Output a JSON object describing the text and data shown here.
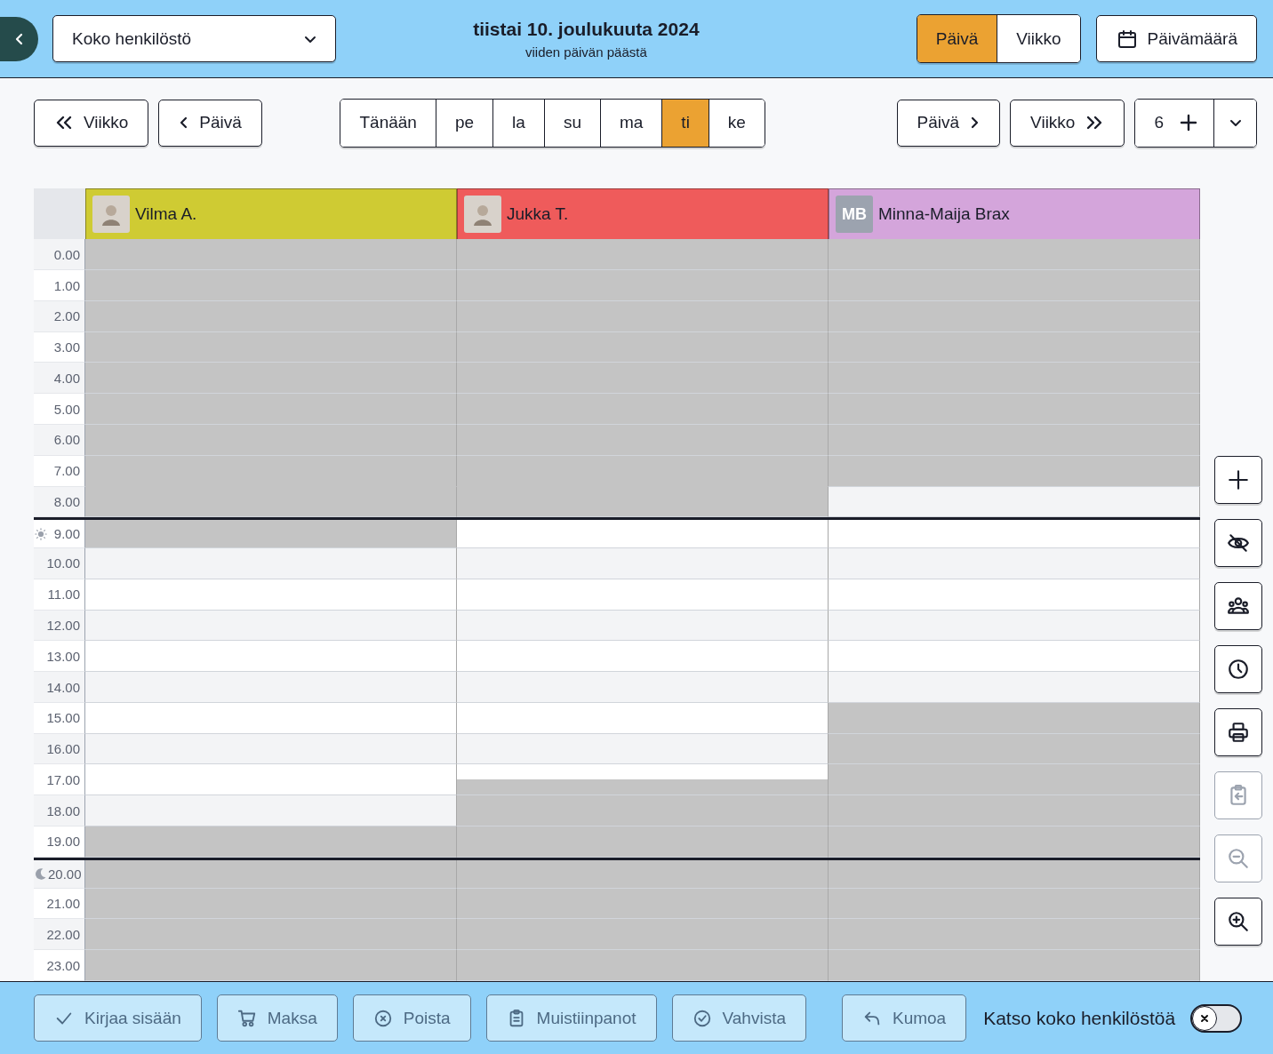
{
  "header": {
    "staff_filter": {
      "value": "Koko henkilöstö"
    },
    "date_title": "tiistai 10. joulukuuta 2024",
    "date_subtitle": "viiden päivän päästä",
    "view_tabs": [
      {
        "label": "Päivä",
        "selected": true
      },
      {
        "label": "Viikko",
        "selected": false
      }
    ],
    "date_button": "Päivämäärä"
  },
  "nav": {
    "back": [
      {
        "label": "Viikko",
        "kind": "week"
      },
      {
        "label": "Päivä",
        "kind": "day"
      }
    ],
    "days": [
      {
        "label": "Tänään",
        "selected": false
      },
      {
        "label": "pe",
        "selected": false
      },
      {
        "label": "la",
        "selected": false
      },
      {
        "label": "su",
        "selected": false
      },
      {
        "label": "ma",
        "selected": false
      },
      {
        "label": "ti",
        "selected": true
      },
      {
        "label": "ke",
        "selected": false
      }
    ],
    "forward": [
      {
        "label": "Päivä",
        "kind": "day"
      },
      {
        "label": "Viikko",
        "kind": "week"
      }
    ],
    "count": "6"
  },
  "calendar": {
    "staff": [
      {
        "name": "Vilma A.",
        "color": "#cfcb33",
        "half_hours": [
          {
            "blocked": true
          },
          {
            "blocked": true
          },
          {
            "blocked": true
          },
          {
            "blocked": true
          },
          {
            "blocked": true
          },
          {
            "blocked": true
          },
          {
            "blocked": true
          },
          {
            "blocked": true
          },
          {
            "blocked": true
          },
          {
            "blocked": true
          },
          {
            "blocked": true
          },
          {
            "blocked": true
          },
          {
            "blocked": true
          },
          {
            "blocked": true
          },
          {
            "blocked": true
          },
          {
            "blocked": true
          },
          {
            "blocked": true
          },
          {
            "blocked": true
          },
          {
            "blocked": true
          },
          {
            "blocked": true
          },
          {
            "blocked": false
          },
          {
            "blocked": false
          },
          {
            "blocked": false
          },
          {
            "blocked": false
          },
          {
            "blocked": false
          },
          {
            "blocked": false
          },
          {
            "blocked": false
          },
          {
            "blocked": false
          },
          {
            "blocked": false
          },
          {
            "blocked": false
          },
          {
            "blocked": false
          },
          {
            "blocked": false
          },
          {
            "blocked": false
          },
          {
            "blocked": false
          },
          {
            "blocked": false
          },
          {
            "blocked": false
          },
          {
            "blocked": false
          },
          {
            "blocked": false
          },
          {
            "blocked": true
          },
          {
            "blocked": true
          },
          {
            "blocked": true
          },
          {
            "blocked": true
          },
          {
            "blocked": true
          },
          {
            "blocked": true
          },
          {
            "blocked": true
          },
          {
            "blocked": true
          },
          {
            "blocked": true
          },
          {
            "blocked": true
          }
        ]
      },
      {
        "name": "Jukka T.",
        "color": "#ef5b5b",
        "half_hours": [
          {
            "blocked": true
          },
          {
            "blocked": true
          },
          {
            "blocked": true
          },
          {
            "blocked": true
          },
          {
            "blocked": true
          },
          {
            "blocked": true
          },
          {
            "blocked": true
          },
          {
            "blocked": true
          },
          {
            "blocked": true
          },
          {
            "blocked": true
          },
          {
            "blocked": true
          },
          {
            "blocked": true
          },
          {
            "blocked": true
          },
          {
            "blocked": true
          },
          {
            "blocked": true
          },
          {
            "blocked": true
          },
          {
            "blocked": true
          },
          {
            "blocked": true
          },
          {
            "blocked": false
          },
          {
            "blocked": false
          },
          {
            "blocked": false
          },
          {
            "blocked": false
          },
          {
            "blocked": false
          },
          {
            "blocked": false
          },
          {
            "blocked": false
          },
          {
            "blocked": false
          },
          {
            "blocked": false
          },
          {
            "blocked": false
          },
          {
            "blocked": false
          },
          {
            "blocked": false
          },
          {
            "blocked": false
          },
          {
            "blocked": false
          },
          {
            "blocked": false
          },
          {
            "blocked": false
          },
          {
            "blocked": false
          },
          {
            "blocked": true
          },
          {
            "blocked": true
          },
          {
            "blocked": true
          },
          {
            "blocked": true
          },
          {
            "blocked": true
          },
          {
            "blocked": true
          },
          {
            "blocked": true
          },
          {
            "blocked": true
          },
          {
            "blocked": true
          },
          {
            "blocked": true
          },
          {
            "blocked": true
          },
          {
            "blocked": true
          },
          {
            "blocked": true
          }
        ]
      },
      {
        "name": "Minna-Maija Brax",
        "color": "#d4a5db",
        "initials": "MB",
        "half_hours": [
          {
            "blocked": true
          },
          {
            "blocked": true
          },
          {
            "blocked": true
          },
          {
            "blocked": true
          },
          {
            "blocked": true
          },
          {
            "blocked": true
          },
          {
            "blocked": true
          },
          {
            "blocked": true
          },
          {
            "blocked": true
          },
          {
            "blocked": true
          },
          {
            "blocked": true
          },
          {
            "blocked": true
          },
          {
            "blocked": true
          },
          {
            "blocked": true
          },
          {
            "blocked": true
          },
          {
            "blocked": true
          },
          {
            "blocked": false
          },
          {
            "blocked": false
          },
          {
            "blocked": false
          },
          {
            "blocked": false
          },
          {
            "blocked": false
          },
          {
            "blocked": false
          },
          {
            "blocked": false
          },
          {
            "blocked": false
          },
          {
            "blocked": false
          },
          {
            "blocked": false
          },
          {
            "blocked": false
          },
          {
            "blocked": false
          },
          {
            "blocked": false
          },
          {
            "blocked": false
          },
          {
            "blocked": true
          },
          {
            "blocked": true
          },
          {
            "blocked": true
          },
          {
            "blocked": true
          },
          {
            "blocked": true
          },
          {
            "blocked": true
          },
          {
            "blocked": true
          },
          {
            "blocked": true
          },
          {
            "blocked": true
          },
          {
            "blocked": true
          },
          {
            "blocked": true
          },
          {
            "blocked": true
          },
          {
            "blocked": true
          },
          {
            "blocked": true
          },
          {
            "blocked": true
          },
          {
            "blocked": true
          },
          {
            "blocked": true
          },
          {
            "blocked": true
          }
        ]
      }
    ],
    "times": [
      {
        "label": "0.00",
        "kind": "hour"
      },
      {
        "label": "1.00",
        "kind": "hour"
      },
      {
        "label": "2.00",
        "kind": "hour"
      },
      {
        "label": "3.00",
        "kind": "hour"
      },
      {
        "label": "4.00",
        "kind": "hour"
      },
      {
        "label": "5.00",
        "kind": "hour"
      },
      {
        "label": "6.00",
        "kind": "hour"
      },
      {
        "label": "7.00",
        "kind": "hour"
      },
      {
        "label": "8.00",
        "kind": "hour"
      },
      {
        "label": "9.00",
        "kind": "daystart"
      },
      {
        "label": "10.00",
        "kind": "hour"
      },
      {
        "label": "11.00",
        "kind": "hour"
      },
      {
        "label": "12.00",
        "kind": "hour"
      },
      {
        "label": "13.00",
        "kind": "hour"
      },
      {
        "label": "14.00",
        "kind": "hour"
      },
      {
        "label": "15.00",
        "kind": "hour"
      },
      {
        "label": "16.00",
        "kind": "hour"
      },
      {
        "label": "17.00",
        "kind": "hour"
      },
      {
        "label": "18.00",
        "kind": "hour"
      },
      {
        "label": "19.00",
        "kind": "hour"
      },
      {
        "label": "20.00",
        "kind": "nightstart"
      },
      {
        "label": "21.00",
        "kind": "hour"
      },
      {
        "label": "22.00",
        "kind": "hour"
      },
      {
        "label": "23.00",
        "kind": "hour"
      }
    ]
  },
  "side_tools": [
    {
      "kind": "add",
      "disabled": false
    },
    {
      "kind": "hide",
      "disabled": false
    },
    {
      "kind": "group",
      "disabled": false
    },
    {
      "kind": "clock",
      "disabled": false
    },
    {
      "kind": "print",
      "disabled": false
    },
    {
      "kind": "paste",
      "disabled": true
    },
    {
      "kind": "zoom_out",
      "disabled": true
    },
    {
      "kind": "zoom_in",
      "disabled": false
    }
  ],
  "actions": [
    {
      "label": "Kirjaa sisään",
      "kind": "check",
      "disabled": true
    },
    {
      "label": "Maksa",
      "kind": "cart",
      "disabled": true
    },
    {
      "label": "Poista",
      "kind": "remove",
      "disabled": true
    },
    {
      "label": "Muistiinpanot",
      "kind": "notes",
      "disabled": true
    },
    {
      "label": "Vahvista",
      "kind": "confirm",
      "disabled": true
    },
    {
      "label": "Kumoa",
      "kind": "undo",
      "disabled": true
    }
  ],
  "show_all_staff": {
    "label": "Katso koko henkilöstöä",
    "on": false
  }
}
